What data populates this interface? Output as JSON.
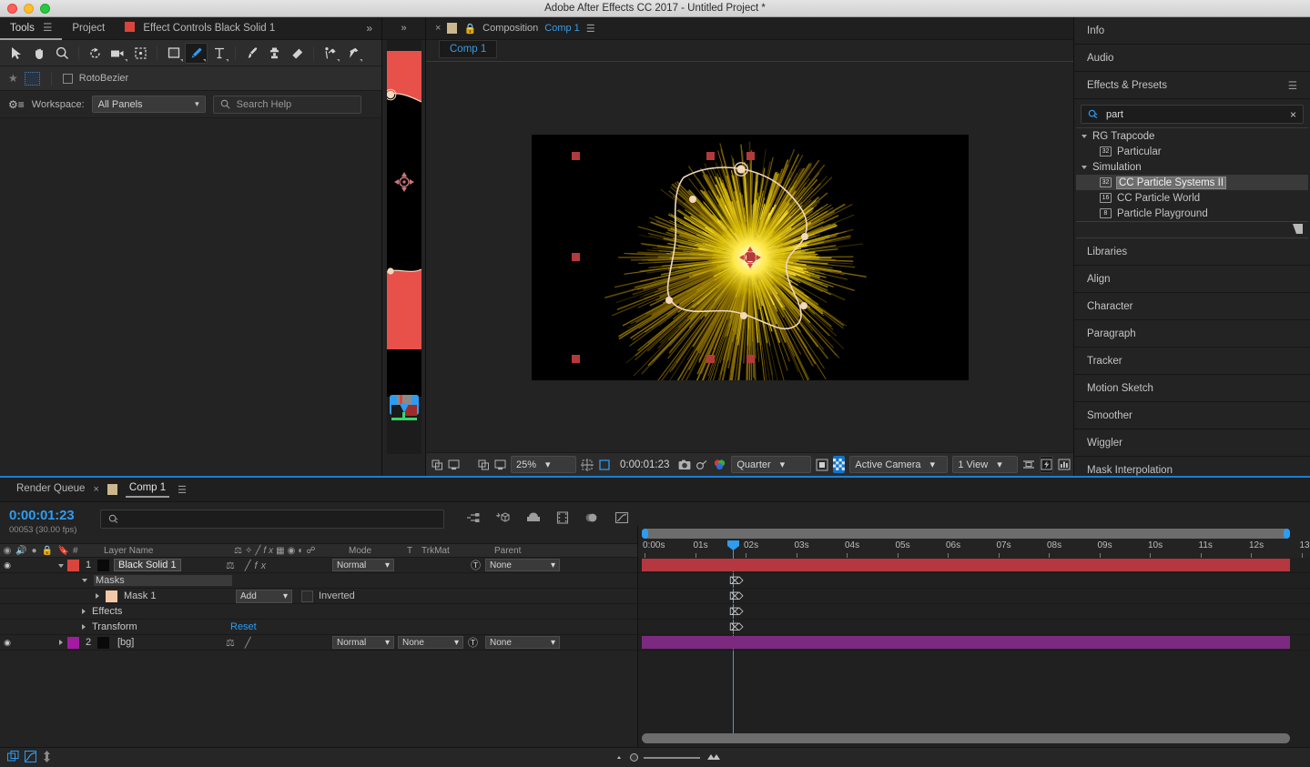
{
  "window": {
    "title": "Adobe After Effects CC 2017 - Untitled Project *"
  },
  "tools_panel": {
    "tabs": [
      {
        "label": "Tools",
        "icon": "menu-icon"
      },
      {
        "label": "Project"
      },
      {
        "label": "Effect Controls Black Solid 1",
        "swatch": "#d9453c"
      }
    ],
    "overflow": "»",
    "tools": [
      "selection-tool",
      "hand-tool",
      "zoom-tool",
      "rotation-tool",
      "camera-tool",
      "anchor-point-tool",
      "shape-tool",
      "pen-tool",
      "text-tool",
      "brush-tool",
      "clone-stamp-tool",
      "eraser-tool",
      "roto-brush-tool",
      "puppet-pin-tool"
    ],
    "active_tool": "pen-tool",
    "options": {
      "rotobezier_label": "RotoBezier",
      "rotobezier_checked": false
    },
    "workspace": {
      "label": "Workspace:",
      "value": "All Panels"
    },
    "search_help_placeholder": "Search Help"
  },
  "composition_panel": {
    "close": "×",
    "label": "Composition",
    "comp_name": "Comp 1",
    "menu_icon": "panel-menu-icon",
    "subtab": "Comp 1",
    "toolbar": {
      "zoom": "25%",
      "time": "0:00:01:23",
      "resolution": "Quarter",
      "camera": "Active Camera",
      "views": "1 View"
    }
  },
  "right_panel": {
    "rows_top": [
      {
        "label": "Info"
      },
      {
        "label": "Audio"
      }
    ],
    "effects_presets": {
      "label": "Effects & Presets",
      "menu_icon": "panel-menu-icon"
    },
    "search": {
      "value": "part",
      "clear": "×"
    },
    "tree": [
      {
        "type": "group",
        "label": "RG Trapcode",
        "expanded": true
      },
      {
        "type": "effect",
        "label": "Particular",
        "badge": "32"
      },
      {
        "type": "group",
        "label": "Simulation",
        "expanded": true
      },
      {
        "type": "effect",
        "label": "CC Particle Systems II",
        "badge": "32",
        "selected": true
      },
      {
        "type": "effect",
        "label": "CC Particle World",
        "badge": "16"
      },
      {
        "type": "effect",
        "label": "Particle Playground",
        "badge": "8"
      }
    ],
    "rows_bottom": [
      {
        "label": "Libraries"
      },
      {
        "label": "Align"
      },
      {
        "label": "Character"
      },
      {
        "label": "Paragraph"
      },
      {
        "label": "Tracker"
      },
      {
        "label": "Motion Sketch"
      },
      {
        "label": "Smoother"
      },
      {
        "label": "Wiggler"
      },
      {
        "label": "Mask Interpolation"
      }
    ]
  },
  "timeline": {
    "tabs": [
      {
        "label": "Render Queue",
        "active": false
      },
      {
        "label": "Comp 1",
        "active": true
      }
    ],
    "close": "×",
    "timecode": {
      "current": "0:00:01:23",
      "frames": "00053 (30.00 fps)"
    },
    "search_placeholder": "",
    "switch_icons": [
      "mini-flowchart-icon",
      "draft-3d-icon",
      "hide-shy-layers-icon",
      "frame-blending-icon",
      "motion-blur-icon",
      "graph-editor-icon"
    ],
    "columns": [
      {
        "label": ""
      },
      {
        "label": "#"
      },
      {
        "label": "Layer Name"
      },
      {
        "label": "Mode"
      },
      {
        "label": "T"
      },
      {
        "label": "TrkMat"
      },
      {
        "label": "Parent"
      }
    ],
    "layers": [
      {
        "index": "1",
        "name": "Black Solid 1",
        "color": "#d9453c",
        "mode": "Normal",
        "trkmat": "",
        "parent": "None",
        "bar_color": "#b5373f",
        "visible": true
      },
      {
        "index": "2",
        "name": "[bg]",
        "color": "#a31aa3",
        "mode": "Normal",
        "trkmat": "None",
        "parent": "None",
        "bar_color": "#7b2a80",
        "visible": true
      }
    ],
    "properties": [
      {
        "label": "Masks",
        "indent": 1,
        "expanded": true,
        "highlight": true
      },
      {
        "label": "Mask 1",
        "indent": 2,
        "expanded": false,
        "swatch": "#f2c9a8",
        "mode": "Add",
        "inverted_label": "Inverted",
        "inverted": false
      },
      {
        "label": "Effects",
        "indent": 1,
        "expanded": false
      },
      {
        "label": "Transform",
        "indent": 1,
        "expanded": false,
        "action": "Reset"
      }
    ],
    "ruler_ticks": [
      "0:00s",
      "01s",
      "02s",
      "03s",
      "04s",
      "05s",
      "06s",
      "07s",
      "08s",
      "09s",
      "10s",
      "11s",
      "12s",
      "13"
    ]
  },
  "colors": {
    "accent_blue": "#2e9cf0",
    "layer_red": "#b5373f",
    "layer_purple": "#7b2a80",
    "particle_yellow": "#e8d41a",
    "mask_path": "#f2d8bd",
    "selection_handle": "#b33a3a"
  }
}
